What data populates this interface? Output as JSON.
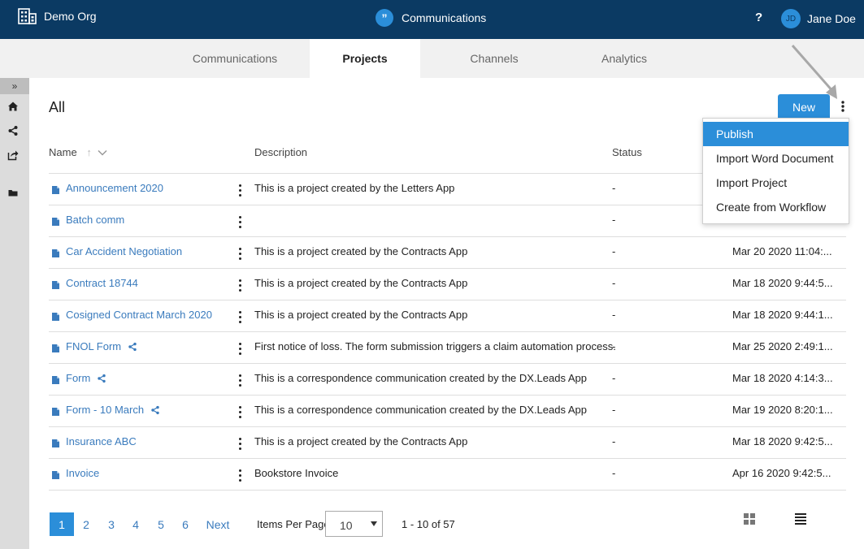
{
  "topbar": {
    "org": "Demo Org",
    "app_title": "Communications",
    "help": "?",
    "user_initials": "JD",
    "user_name": "Jane Doe"
  },
  "tabs": [
    {
      "label": "Communications",
      "active": false
    },
    {
      "label": "Projects",
      "active": true
    },
    {
      "label": "Channels",
      "active": false
    },
    {
      "label": "Analytics",
      "active": false
    }
  ],
  "rail": {
    "expand": "»"
  },
  "main": {
    "heading": "All",
    "new_label": "New"
  },
  "table": {
    "headers": {
      "name": "Name",
      "sort": "↑",
      "description": "Description",
      "status": "Status"
    },
    "rows": [
      {
        "name": "Announcement 2020",
        "shared": false,
        "description": "This is a project created by the Letters App",
        "status": "-",
        "modified": ""
      },
      {
        "name": "Batch comm",
        "shared": false,
        "description": "",
        "status": "-",
        "modified": ""
      },
      {
        "name": "Car Accident Negotiation",
        "shared": false,
        "description": "This is a project created by the Contracts App",
        "status": "-",
        "modified": "Mar 20 2020 11:04:..."
      },
      {
        "name": "Contract 18744",
        "shared": false,
        "description": "This is a project created by the Contracts App",
        "status": "-",
        "modified": "Mar 18 2020 9:44:5..."
      },
      {
        "name": "Cosigned Contract March 2020",
        "shared": false,
        "description": "This is a project created by the Contracts App",
        "status": "-",
        "modified": "Mar 18 2020 9:44:1..."
      },
      {
        "name": "FNOL Form",
        "shared": true,
        "description": "First notice of loss. The form submission triggers a claim automation process.",
        "status": "-",
        "modified": "Mar 25 2020 2:49:1..."
      },
      {
        "name": "Form",
        "shared": true,
        "description": "This is a correspondence communication created by the DX.Leads App",
        "status": "-",
        "modified": "Mar 18 2020 4:14:3..."
      },
      {
        "name": "Form - 10 March",
        "shared": true,
        "description": "This is a correspondence communication created by the DX.Leads App",
        "status": "-",
        "modified": "Mar 19 2020 8:20:1..."
      },
      {
        "name": "Insurance ABC",
        "shared": false,
        "description": "This is a project created by the Contracts App",
        "status": "-",
        "modified": "Mar 18 2020 9:42:5..."
      },
      {
        "name": "Invoice",
        "shared": false,
        "description": "Bookstore Invoice",
        "status": "-",
        "modified": "Apr 16 2020 9:42:5..."
      }
    ]
  },
  "menu": {
    "items": [
      {
        "label": "Publish",
        "active": true
      },
      {
        "label": "Import Word Document",
        "active": false
      },
      {
        "label": "Import Project",
        "active": false
      },
      {
        "label": "Create from Workflow",
        "active": false
      }
    ]
  },
  "pagination": {
    "pages": [
      "1",
      "2",
      "3",
      "4",
      "5",
      "6"
    ],
    "current": "1",
    "next": "Next",
    "items_per_page_label": "Items Per Page",
    "items_per_page": "10",
    "range": "1 - 10 of 57"
  },
  "colors": {
    "topbar": "#0b3a63",
    "accent": "#2b8ed9",
    "link": "#3a7bbd"
  },
  "icons": [
    "building-icon",
    "quote-icon",
    "help-icon",
    "home-icon",
    "share-icon",
    "export-icon",
    "folder-icon",
    "document-icon",
    "kebab-icon",
    "grid-view-icon",
    "list-view-icon"
  ]
}
